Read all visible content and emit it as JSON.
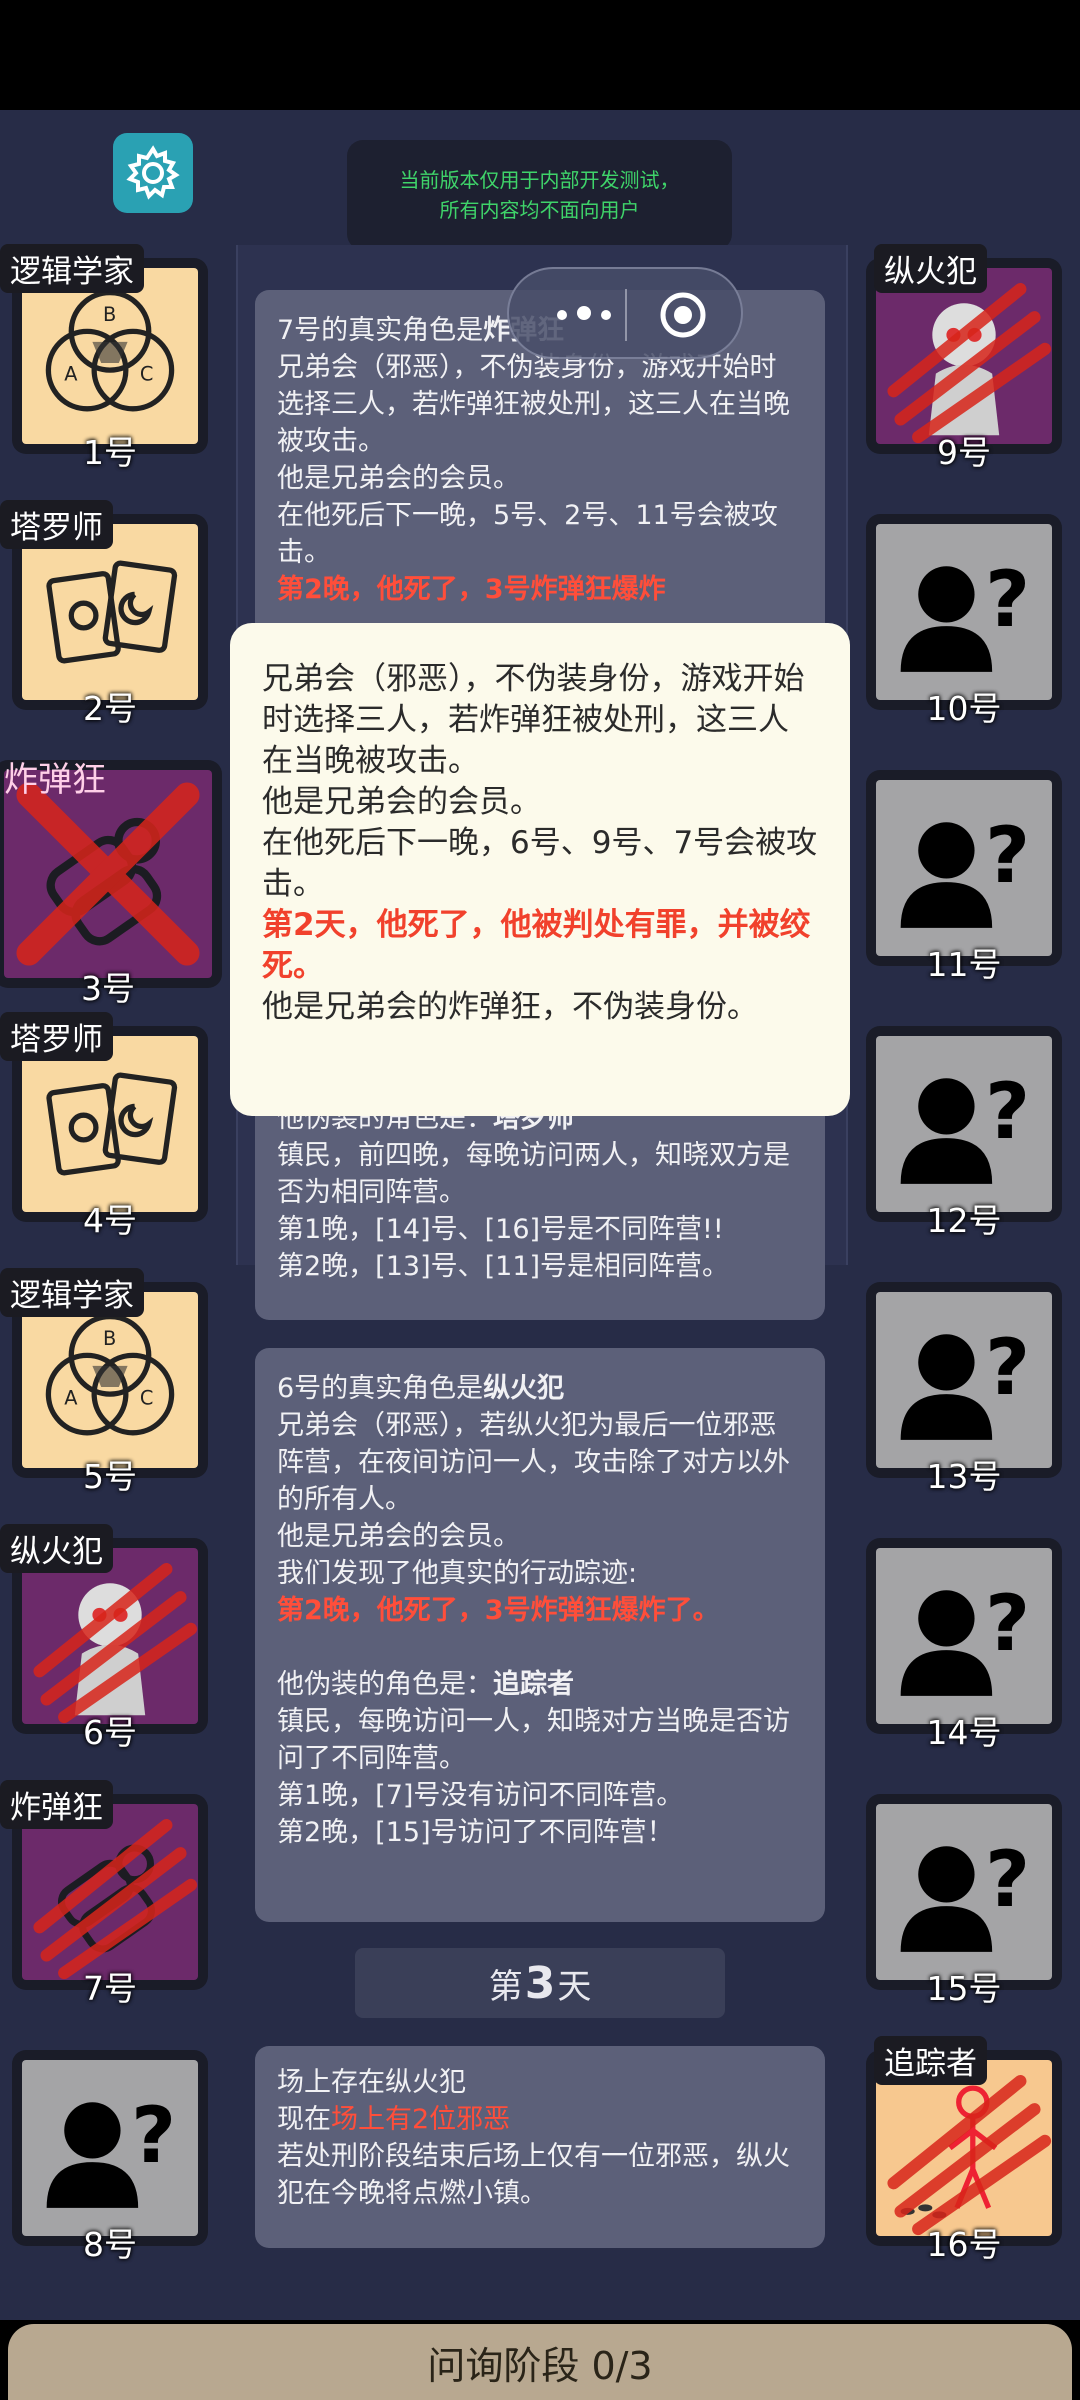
{
  "notice": {
    "line1": "当前版本仅用于内部开发测试，",
    "line2": "所有内容均不面向用户"
  },
  "players": [
    {
      "num": "1号",
      "role": "逻辑学家",
      "art": "venn",
      "bg": "cream",
      "dead": false
    },
    {
      "num": "2号",
      "role": "塔罗师",
      "art": "tarot",
      "bg": "cream",
      "dead": false
    },
    {
      "num": "3号",
      "role": "炸弹狂",
      "art": "bomb",
      "bg": "purple",
      "dead": true
    },
    {
      "num": "4号",
      "role": "塔罗师",
      "art": "tarot",
      "bg": "cream",
      "dead": false
    },
    {
      "num": "5号",
      "role": "逻辑学家",
      "art": "venn",
      "bg": "cream",
      "dead": false
    },
    {
      "num": "6号",
      "role": "纵火犯",
      "art": "arsonist",
      "bg": "purple",
      "dead": true
    },
    {
      "num": "7号",
      "role": "炸弹狂",
      "art": "bomb",
      "bg": "purple",
      "dead": true
    },
    {
      "num": "8号",
      "role": "",
      "art": "unknown",
      "bg": "grey",
      "dead": false
    },
    {
      "num": "9号",
      "role": "纵火犯",
      "art": "arsonist",
      "bg": "purple",
      "dead": true
    },
    {
      "num": "10号",
      "role": "",
      "art": "unknown",
      "bg": "grey",
      "dead": false
    },
    {
      "num": "11号",
      "role": "",
      "art": "unknown",
      "bg": "grey",
      "dead": false
    },
    {
      "num": "12号",
      "role": "",
      "art": "unknown",
      "bg": "grey",
      "dead": false
    },
    {
      "num": "13号",
      "role": "",
      "art": "unknown",
      "bg": "grey",
      "dead": false
    },
    {
      "num": "14号",
      "role": "",
      "art": "unknown",
      "bg": "grey",
      "dead": false
    },
    {
      "num": "15号",
      "role": "",
      "art": "unknown",
      "bg": "grey",
      "dead": false
    },
    {
      "num": "16号",
      "role": "追踪者",
      "art": "tracker",
      "bg": "peach",
      "dead": true
    }
  ],
  "card1": {
    "title_prefix": "7号的真实角色是",
    "title_role": "炸弹狂",
    "desc": "兄弟会（邪恶），不伪装身份，游戏开始时选择三人，若炸弹狂被处刑，这三人在当晚被攻击。",
    "member": "他是兄弟会的会员。",
    "after": "在他死后下一晚，5号、2号、11号会被攻击。",
    "death": "第2晚，他死了，3号炸弹狂爆炸"
  },
  "card2": {
    "fake_prefix": "他伪装的角色是：",
    "fake_role": "塔罗师",
    "desc": "镇民，前四晚，每晚访问两人，知晓双方是否为相同阵营。",
    "n1": "第1晚，[14]号、[16]号是不同阵营!!",
    "n2": "第2晚，[13]号、[11]号是相同阵营。"
  },
  "card3": {
    "title_prefix": "6号的真实角色是",
    "title_role": "纵火犯",
    "desc": "兄弟会（邪恶），若纵火犯为最后一位邪恶阵营，在夜间访问一人，攻击除了对方以外的所有人。",
    "member": "他是兄弟会的会员。",
    "found": "我们发现了他真实的行动踪迹:",
    "death": "第2晚，他死了，3号炸弹狂爆炸了。",
    "fake_prefix": "他伪装的角色是：",
    "fake_role": "追踪者",
    "fake_desc": "镇民，每晚访问一人，知晓对方当晚是否访问了不同阵营。",
    "n1": "第1晚，[7]号没有访问不同阵营。",
    "n2": "第2晚，[15]号访问了不同阵营！"
  },
  "day": {
    "prefix": "第",
    "num": "3",
    "suffix": "天"
  },
  "card4": {
    "l1": "场上存在纵火犯",
    "l2_prefix": "现在",
    "l2_red": "场上有2位邪恶",
    "l3": "若处刑阶段结束后场上仅有一位邪恶，纵火犯在今晚将点燃小镇。"
  },
  "tooltip": {
    "desc": "兄弟会（邪恶），不伪装身份，游戏开始时选择三人，若炸弹狂被处刑，这三人在当晚被攻击。",
    "member": "他是兄弟会的会员。",
    "after": "在他死后下一晚，6号、9号、7号会被攻击。",
    "death": "第2天，他死了，他被判处有罪，并被绞死。",
    "note": "他是兄弟会的炸弹狂，不伪装身份。"
  },
  "phase": "问询阶段 0/3",
  "colors": {
    "accent_red": "#ff4e3a",
    "notice_green": "#3fd46a",
    "gear": "#2aa1b3"
  }
}
